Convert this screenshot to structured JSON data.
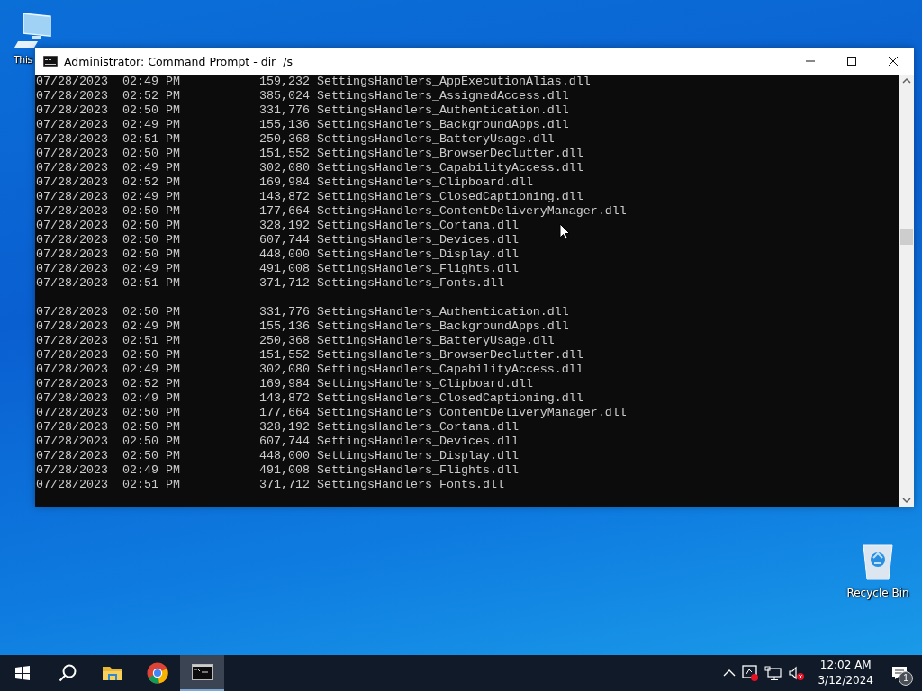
{
  "desktop": {
    "icons": [
      {
        "kind": "computer",
        "label": "This"
      },
      {
        "kind": "recycle",
        "label": "Recycle Bin"
      }
    ]
  },
  "window": {
    "title": "Administrator: Command Prompt - dir  /s",
    "blocks": [
      {
        "lines": [
          "07/28/2023  02:49 PM           159,232 SettingsHandlers_AppExecutionAlias.dll",
          "07/28/2023  02:52 PM           385,024 SettingsHandlers_AssignedAccess.dll",
          "07/28/2023  02:50 PM           331,776 SettingsHandlers_Authentication.dll",
          "07/28/2023  02:49 PM           155,136 SettingsHandlers_BackgroundApps.dll",
          "07/28/2023  02:51 PM           250,368 SettingsHandlers_BatteryUsage.dll",
          "07/28/2023  02:50 PM           151,552 SettingsHandlers_BrowserDeclutter.dll",
          "07/28/2023  02:49 PM           302,080 SettingsHandlers_CapabilityAccess.dll",
          "07/28/2023  02:52 PM           169,984 SettingsHandlers_Clipboard.dll",
          "07/28/2023  02:49 PM           143,872 SettingsHandlers_ClosedCaptioning.dll",
          "07/28/2023  02:50 PM           177,664 SettingsHandlers_ContentDeliveryManager.dll",
          "07/28/2023  02:50 PM           328,192 SettingsHandlers_Cortana.dll",
          "07/28/2023  02:50 PM           607,744 SettingsHandlers_Devices.dll",
          "07/28/2023  02:50 PM           448,000 SettingsHandlers_Display.dll",
          "07/28/2023  02:49 PM           491,008 SettingsHandlers_Flights.dll",
          "07/28/2023  02:51 PM           371,712 SettingsHandlers_Fonts.dll"
        ]
      },
      {
        "lines": [
          "07/28/2023  02:50 PM           331,776 SettingsHandlers_Authentication.dll",
          "07/28/2023  02:49 PM           155,136 SettingsHandlers_BackgroundApps.dll",
          "07/28/2023  02:51 PM           250,368 SettingsHandlers_BatteryUsage.dll",
          "07/28/2023  02:50 PM           151,552 SettingsHandlers_BrowserDeclutter.dll",
          "07/28/2023  02:49 PM           302,080 SettingsHandlers_CapabilityAccess.dll",
          "07/28/2023  02:52 PM           169,984 SettingsHandlers_Clipboard.dll",
          "07/28/2023  02:49 PM           143,872 SettingsHandlers_ClosedCaptioning.dll",
          "07/28/2023  02:50 PM           177,664 SettingsHandlers_ContentDeliveryManager.dll",
          "07/28/2023  02:50 PM           328,192 SettingsHandlers_Cortana.dll",
          "07/28/2023  02:50 PM           607,744 SettingsHandlers_Devices.dll",
          "07/28/2023  02:50 PM           448,000 SettingsHandlers_Display.dll",
          "07/28/2023  02:49 PM           491,008 SettingsHandlers_Flights.dll",
          "07/28/2023  02:51 PM           371,712 SettingsHandlers_Fonts.dll"
        ]
      }
    ]
  },
  "taskbar": {
    "items": [
      {
        "kind": "start",
        "selected": false
      },
      {
        "kind": "search",
        "selected": false
      },
      {
        "kind": "explorer",
        "selected": false
      },
      {
        "kind": "chrome",
        "selected": false
      },
      {
        "kind": "cmd",
        "selected": true
      }
    ],
    "time": "12:02 AM",
    "date": "3/12/2024",
    "notifications": "1"
  }
}
